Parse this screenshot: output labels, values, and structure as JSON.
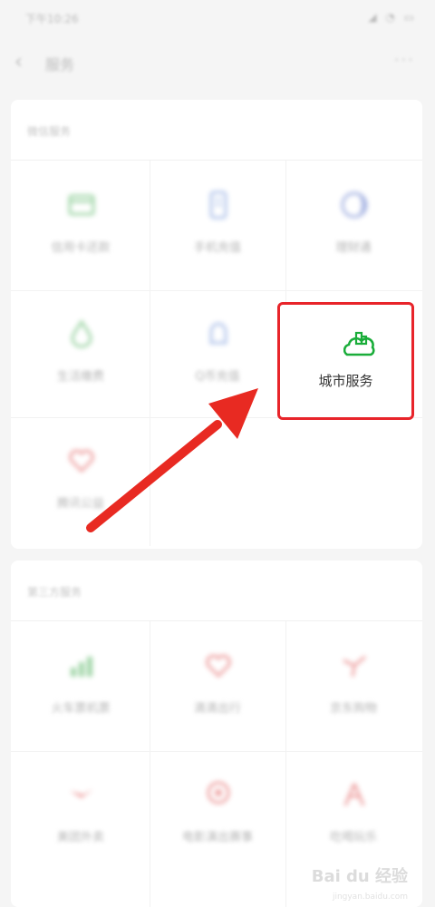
{
  "status_bar": {
    "time": "下午10:26",
    "icons": "◢ ◔ ▭"
  },
  "nav": {
    "title": "服务",
    "back_icon": "back-icon",
    "more_icon": "more-icon"
  },
  "section1": {
    "title": "微信服务",
    "items": [
      {
        "label": "信用卡还款",
        "icon": "card-icon",
        "color": "#6fbf7a"
      },
      {
        "label": "手机充值",
        "icon": "phone-icon",
        "color": "#8aa6e0"
      },
      {
        "label": "理财通",
        "icon": "moon-icon",
        "color": "#7b8fd4"
      },
      {
        "label": "生活缴费",
        "icon": "drop-icon",
        "color": "#6fbf7a"
      },
      {
        "label": "Q币充值",
        "icon": "bell-icon",
        "color": "#8aa6e0"
      },
      {
        "label": "城市服务",
        "icon": "city-icon",
        "color": "#1aad3a"
      },
      {
        "label": "腾讯公益",
        "icon": "heart-icon",
        "color": "#e57373"
      }
    ]
  },
  "section2": {
    "title": "第三方服务",
    "items": [
      {
        "label": "火车票机票",
        "icon": "chart-icon",
        "color": "#6fbf7a"
      },
      {
        "label": "滴滴出行",
        "icon": "heart-outline-icon",
        "color": "#e57373"
      },
      {
        "label": "京东购物",
        "icon": "fan-icon",
        "color": "#e57373"
      },
      {
        "label": "美团外卖",
        "icon": "bird-icon",
        "color": "#e57373"
      },
      {
        "label": "电影演出赛事",
        "icon": "badge-icon",
        "color": "#e57373"
      },
      {
        "label": "吃喝玩乐",
        "icon": "tent-icon",
        "color": "#e57373"
      }
    ]
  },
  "watermark": {
    "text": "Bai du 经验",
    "sub": "jingyan.baidu.com"
  }
}
